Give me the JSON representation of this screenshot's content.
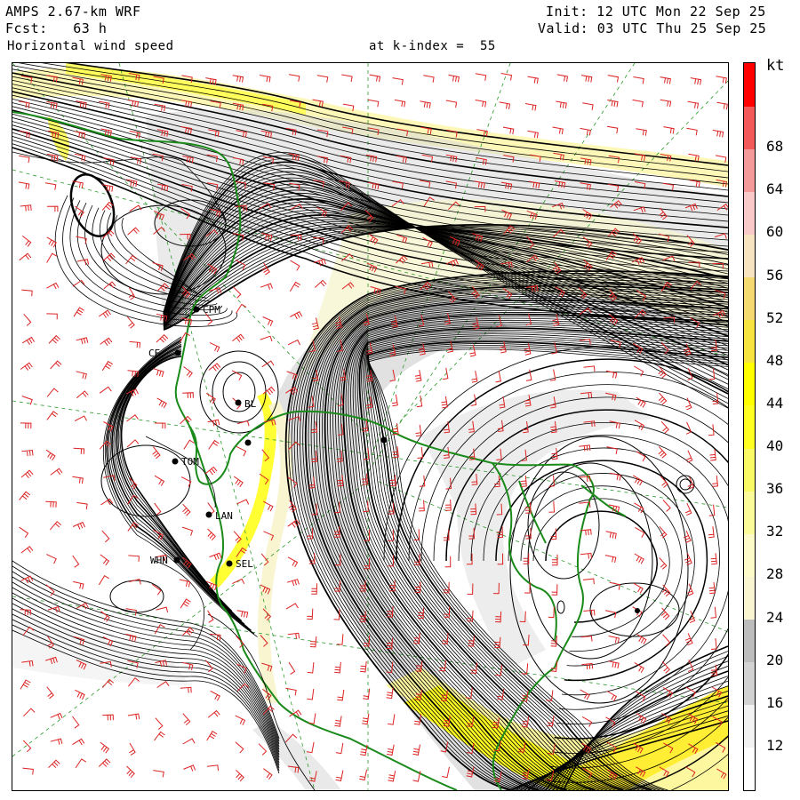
{
  "header": {
    "model": "AMPS 2.67-km WRF",
    "forecast": "Fcst:   63 h",
    "field": "Horizontal wind speed",
    "level": "at k-index =  55",
    "init": "Init: 12 UTC Mon 22 Sep 25",
    "valid": "Valid: 03 UTC Thu 25 Sep 25"
  },
  "colorbar": {
    "unit": "kt",
    "bins": [
      {
        "lo": 8,
        "hi": 12,
        "color": "#ffffff"
      },
      {
        "lo": 12,
        "hi": 16,
        "color": "#f2f2f2"
      },
      {
        "lo": 16,
        "hi": 20,
        "color": "#d2d2d2"
      },
      {
        "lo": 20,
        "hi": 24,
        "color": "#bdbdbd"
      },
      {
        "lo": 24,
        "hi": 28,
        "color": "#f8f5d0"
      },
      {
        "lo": 28,
        "hi": 32,
        "color": "#fdfcc8"
      },
      {
        "lo": 32,
        "hi": 36,
        "color": "#fbfb9a"
      },
      {
        "lo": 36,
        "hi": 40,
        "color": "#fafa66"
      },
      {
        "lo": 40,
        "hi": 44,
        "color": "#ffff22"
      },
      {
        "lo": 44,
        "hi": 48,
        "color": "#ffff00"
      },
      {
        "lo": 48,
        "hi": 52,
        "color": "#f8e440"
      },
      {
        "lo": 52,
        "hi": 56,
        "color": "#f4d870"
      },
      {
        "lo": 56,
        "hi": 60,
        "color": "#f7e3bf"
      },
      {
        "lo": 60,
        "hi": 64,
        "color": "#f9c8c8"
      },
      {
        "lo": 64,
        "hi": 68,
        "color": "#f59a9a"
      },
      {
        "lo": 68,
        "hi": 72,
        "color": "#f25a5a"
      },
      {
        "lo": 72,
        "hi": 76,
        "color": "#ff0000"
      }
    ],
    "labels": [
      "68",
      "64",
      "60",
      "56",
      "52",
      "48",
      "44",
      "40",
      "36",
      "32",
      "28",
      "24",
      "20",
      "16",
      "12"
    ]
  },
  "stations": [
    {
      "id": "CPM"
    },
    {
      "id": "CE"
    },
    {
      "id": "BL"
    },
    {
      "id": "TOM"
    },
    {
      "id": "LAN"
    },
    {
      "id": "WHN"
    },
    {
      "id": "SEL"
    }
  ],
  "colors": {
    "coastline": "#1a8a1a",
    "barbs": "#dd2222",
    "streamlines": "#000000",
    "gridlines": "#2a9a2a"
  }
}
